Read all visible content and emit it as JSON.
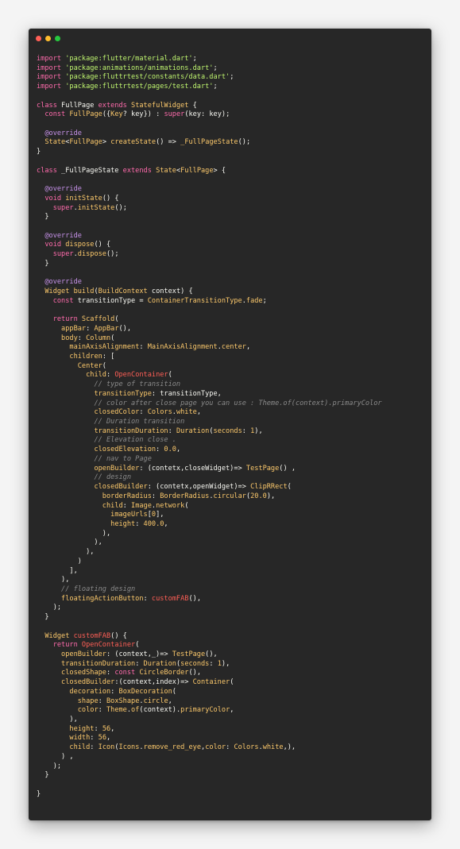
{
  "window": {
    "controls": [
      "close",
      "minimize",
      "maximize"
    ]
  },
  "colors": {
    "keyword": "#ff6bac",
    "string": "#bff56f",
    "type": "#fbc86b",
    "annotation": "#c792ea",
    "comment": "#8a8a8a",
    "error": "#ff5f56",
    "text": "#f8f8f2",
    "background": "#272727"
  },
  "code_lines": [
    [
      [
        "kw",
        "import "
      ],
      [
        "str",
        "'package:flutter/material.dart'"
      ],
      [
        "p",
        ";"
      ]
    ],
    [
      [
        "kw",
        "import "
      ],
      [
        "str",
        "'package:animations/animations.dart'"
      ],
      [
        "p",
        ";"
      ]
    ],
    [
      [
        "kw",
        "import "
      ],
      [
        "str",
        "'package:fluttrtest/constants/data.dart'"
      ],
      [
        "p",
        ";"
      ]
    ],
    [
      [
        "kw",
        "import "
      ],
      [
        "str",
        "'package:fluttrtest/pages/test.dart'"
      ],
      [
        "p",
        ";"
      ]
    ],
    [],
    [
      [
        "kw",
        "class "
      ],
      [
        "id",
        "FullPage "
      ],
      [
        "kw",
        "extends "
      ],
      [
        "cls",
        "StatefulWidget"
      ],
      [
        "p",
        " {"
      ]
    ],
    [
      [
        "p",
        "  "
      ],
      [
        "kw",
        "const "
      ],
      [
        "fn",
        "FullPage"
      ],
      [
        "p",
        "({"
      ],
      [
        "cls",
        "Key"
      ],
      [
        "p",
        "? key}) : "
      ],
      [
        "kw",
        "super"
      ],
      [
        "p",
        "(key: key);"
      ]
    ],
    [],
    [
      [
        "p",
        "  "
      ],
      [
        "ann",
        "@override"
      ]
    ],
    [
      [
        "p",
        "  "
      ],
      [
        "cls",
        "State"
      ],
      [
        "p",
        "<"
      ],
      [
        "cls",
        "FullPage"
      ],
      [
        "p",
        "> "
      ],
      [
        "fn",
        "createState"
      ],
      [
        "p",
        "() => "
      ],
      [
        "fn",
        "_FullPageState"
      ],
      [
        "p",
        "();"
      ]
    ],
    [
      [
        "p",
        "}"
      ]
    ],
    [],
    [
      [
        "kw",
        "class "
      ],
      [
        "id",
        "_FullPageState "
      ],
      [
        "kw",
        "extends "
      ],
      [
        "cls",
        "State"
      ],
      [
        "p",
        "<"
      ],
      [
        "cls",
        "FullPage"
      ],
      [
        "p",
        "> {"
      ]
    ],
    [],
    [
      [
        "p",
        "  "
      ],
      [
        "ann",
        "@override"
      ]
    ],
    [
      [
        "p",
        "  "
      ],
      [
        "kw",
        "void "
      ],
      [
        "fn",
        "initState"
      ],
      [
        "p",
        "() {"
      ]
    ],
    [
      [
        "p",
        "    "
      ],
      [
        "kw",
        "super"
      ],
      [
        "p",
        "."
      ],
      [
        "fn",
        "initState"
      ],
      [
        "p",
        "();"
      ]
    ],
    [
      [
        "p",
        "  }"
      ]
    ],
    [],
    [
      [
        "p",
        "  "
      ],
      [
        "ann",
        "@override"
      ]
    ],
    [
      [
        "p",
        "  "
      ],
      [
        "kw",
        "void "
      ],
      [
        "fn",
        "dispose"
      ],
      [
        "p",
        "() {"
      ]
    ],
    [
      [
        "p",
        "    "
      ],
      [
        "kw",
        "super"
      ],
      [
        "p",
        "."
      ],
      [
        "fn",
        "dispose"
      ],
      [
        "p",
        "();"
      ]
    ],
    [
      [
        "p",
        "  }"
      ]
    ],
    [],
    [
      [
        "p",
        "  "
      ],
      [
        "ann",
        "@override"
      ]
    ],
    [
      [
        "p",
        "  "
      ],
      [
        "cls",
        "Widget "
      ],
      [
        "fn",
        "build"
      ],
      [
        "p",
        "("
      ],
      [
        "cls",
        "BuildContext"
      ],
      [
        "p",
        " context) {"
      ]
    ],
    [
      [
        "p",
        "    "
      ],
      [
        "kw",
        "const "
      ],
      [
        "id",
        "transitionType "
      ],
      [
        "p",
        "= "
      ],
      [
        "cls",
        "ContainerTransitionType"
      ],
      [
        "p",
        "."
      ],
      [
        "prop",
        "fade"
      ],
      [
        "p",
        ";"
      ]
    ],
    [],
    [
      [
        "p",
        "    "
      ],
      [
        "kw",
        "return "
      ],
      [
        "cls",
        "Scaffold"
      ],
      [
        "p",
        "("
      ]
    ],
    [
      [
        "p",
        "      "
      ],
      [
        "prop",
        "appBar"
      ],
      [
        "p",
        ": "
      ],
      [
        "cls",
        "AppBar"
      ],
      [
        "p",
        "(),"
      ]
    ],
    [
      [
        "p",
        "      "
      ],
      [
        "prop",
        "body"
      ],
      [
        "p",
        ": "
      ],
      [
        "cls",
        "Column"
      ],
      [
        "p",
        "("
      ]
    ],
    [
      [
        "p",
        "        "
      ],
      [
        "prop",
        "mainAxisAlignment"
      ],
      [
        "p",
        ": "
      ],
      [
        "cls",
        "MainAxisAlignment"
      ],
      [
        "p",
        "."
      ],
      [
        "prop",
        "center"
      ],
      [
        "p",
        ","
      ]
    ],
    [
      [
        "p",
        "        "
      ],
      [
        "prop",
        "children"
      ],
      [
        "p",
        ": ["
      ]
    ],
    [
      [
        "p",
        "          "
      ],
      [
        "cls",
        "Center"
      ],
      [
        "p",
        "("
      ]
    ],
    [
      [
        "p",
        "            "
      ],
      [
        "prop",
        "child"
      ],
      [
        "p",
        ": "
      ],
      [
        "err",
        "OpenContainer"
      ],
      [
        "p",
        "("
      ]
    ],
    [
      [
        "p",
        "              "
      ],
      [
        "cmt",
        "// type of transition"
      ]
    ],
    [
      [
        "p",
        "              "
      ],
      [
        "prop",
        "transitionType"
      ],
      [
        "p",
        ": transitionType,"
      ]
    ],
    [
      [
        "p",
        "              "
      ],
      [
        "cmt",
        "// color after close page you can use : Theme.of(context).primaryColor"
      ]
    ],
    [
      [
        "p",
        "              "
      ],
      [
        "prop",
        "closedColor"
      ],
      [
        "p",
        ": "
      ],
      [
        "cls",
        "Colors"
      ],
      [
        "p",
        "."
      ],
      [
        "prop",
        "white"
      ],
      [
        "p",
        ","
      ]
    ],
    [
      [
        "p",
        "              "
      ],
      [
        "cmt",
        "// Duration transition"
      ]
    ],
    [
      [
        "p",
        "              "
      ],
      [
        "prop",
        "transitionDuration"
      ],
      [
        "p",
        ": "
      ],
      [
        "cls",
        "Duration"
      ],
      [
        "p",
        "("
      ],
      [
        "prop",
        "seconds"
      ],
      [
        "p",
        ": "
      ],
      [
        "num",
        "1"
      ],
      [
        "p",
        "),"
      ]
    ],
    [
      [
        "p",
        "              "
      ],
      [
        "cmt",
        "// Elevation close ."
      ]
    ],
    [
      [
        "p",
        "              "
      ],
      [
        "prop",
        "closedElevation"
      ],
      [
        "p",
        ": "
      ],
      [
        "num",
        "0.0"
      ],
      [
        "p",
        ","
      ]
    ],
    [
      [
        "p",
        "              "
      ],
      [
        "cmt",
        "// nav to Page"
      ]
    ],
    [
      [
        "p",
        "              "
      ],
      [
        "prop",
        "openBuilder"
      ],
      [
        "p",
        ": (contetx,closeWidget)=> "
      ],
      [
        "cls",
        "TestPage"
      ],
      [
        "p",
        "() ,"
      ]
    ],
    [
      [
        "p",
        "              "
      ],
      [
        "cmt",
        "// design"
      ]
    ],
    [
      [
        "p",
        "              "
      ],
      [
        "prop",
        "closedBuilder"
      ],
      [
        "p",
        ": (contetx,openWidget)=> "
      ],
      [
        "cls",
        "ClipRRect"
      ],
      [
        "p",
        "("
      ]
    ],
    [
      [
        "p",
        "                "
      ],
      [
        "prop",
        "borderRadius"
      ],
      [
        "p",
        ": "
      ],
      [
        "cls",
        "BorderRadius"
      ],
      [
        "p",
        "."
      ],
      [
        "fn",
        "circular"
      ],
      [
        "p",
        "("
      ],
      [
        "num",
        "20.0"
      ],
      [
        "p",
        "),"
      ]
    ],
    [
      [
        "p",
        "                "
      ],
      [
        "prop",
        "child"
      ],
      [
        "p",
        ": "
      ],
      [
        "cls",
        "Image"
      ],
      [
        "p",
        "."
      ],
      [
        "fn",
        "network"
      ],
      [
        "p",
        "("
      ]
    ],
    [
      [
        "p",
        "                  "
      ],
      [
        "prop",
        "imageUrls"
      ],
      [
        "p",
        "["
      ],
      [
        "num",
        "0"
      ],
      [
        "p",
        "],"
      ]
    ],
    [
      [
        "p",
        "                  "
      ],
      [
        "prop",
        "height"
      ],
      [
        "p",
        ": "
      ],
      [
        "num",
        "400.0"
      ],
      [
        "p",
        ","
      ]
    ],
    [
      [
        "p",
        "                ),"
      ]
    ],
    [
      [
        "p",
        "              ),"
      ]
    ],
    [
      [
        "p",
        "            ),"
      ]
    ],
    [
      [
        "p",
        "          )"
      ]
    ],
    [
      [
        "p",
        "        ],"
      ]
    ],
    [
      [
        "p",
        "      ),"
      ]
    ],
    [
      [
        "p",
        "      "
      ],
      [
        "cmt",
        "// floating design"
      ]
    ],
    [
      [
        "p",
        "      "
      ],
      [
        "prop",
        "floatingActionButton"
      ],
      [
        "p",
        ": "
      ],
      [
        "err",
        "customFAB"
      ],
      [
        "p",
        "(),"
      ]
    ],
    [
      [
        "p",
        "    );"
      ]
    ],
    [
      [
        "p",
        "  }"
      ]
    ],
    [],
    [
      [
        "p",
        "  "
      ],
      [
        "cls",
        "Widget "
      ],
      [
        "err",
        "customFAB"
      ],
      [
        "p",
        "() {"
      ]
    ],
    [
      [
        "p",
        "    "
      ],
      [
        "kw",
        "return "
      ],
      [
        "err",
        "OpenContainer"
      ],
      [
        "p",
        "("
      ]
    ],
    [
      [
        "p",
        "      "
      ],
      [
        "prop",
        "openBuilder"
      ],
      [
        "p",
        ": (context,_)=> "
      ],
      [
        "cls",
        "TestPage"
      ],
      [
        "p",
        "(),"
      ]
    ],
    [
      [
        "p",
        "      "
      ],
      [
        "prop",
        "transitionDuration"
      ],
      [
        "p",
        ": "
      ],
      [
        "cls",
        "Duration"
      ],
      [
        "p",
        "("
      ],
      [
        "prop",
        "seconds"
      ],
      [
        "p",
        ": "
      ],
      [
        "num",
        "1"
      ],
      [
        "p",
        "),"
      ]
    ],
    [
      [
        "p",
        "      "
      ],
      [
        "prop",
        "closedShape"
      ],
      [
        "p",
        ": "
      ],
      [
        "kw",
        "const "
      ],
      [
        "cls",
        "CircleBorder"
      ],
      [
        "p",
        "(),"
      ]
    ],
    [
      [
        "p",
        "      "
      ],
      [
        "prop",
        "closedBuilder"
      ],
      [
        "p",
        ":(context,index)=> "
      ],
      [
        "cls",
        "Container"
      ],
      [
        "p",
        "("
      ]
    ],
    [
      [
        "p",
        "        "
      ],
      [
        "prop",
        "decoration"
      ],
      [
        "p",
        ": "
      ],
      [
        "cls",
        "BoxDecoration"
      ],
      [
        "p",
        "("
      ]
    ],
    [
      [
        "p",
        "          "
      ],
      [
        "prop",
        "shape"
      ],
      [
        "p",
        ": "
      ],
      [
        "cls",
        "BoxShape"
      ],
      [
        "p",
        "."
      ],
      [
        "prop",
        "circle"
      ],
      [
        "p",
        ","
      ]
    ],
    [
      [
        "p",
        "          "
      ],
      [
        "prop",
        "color"
      ],
      [
        "p",
        ": "
      ],
      [
        "cls",
        "Theme"
      ],
      [
        "p",
        "."
      ],
      [
        "fn",
        "of"
      ],
      [
        "p",
        "(context)."
      ],
      [
        "prop",
        "primaryColor"
      ],
      [
        "p",
        ","
      ]
    ],
    [
      [
        "p",
        "        ),"
      ]
    ],
    [
      [
        "p",
        "        "
      ],
      [
        "prop",
        "height"
      ],
      [
        "p",
        ": "
      ],
      [
        "num",
        "56"
      ],
      [
        "p",
        ","
      ]
    ],
    [
      [
        "p",
        "        "
      ],
      [
        "prop",
        "width"
      ],
      [
        "p",
        ": "
      ],
      [
        "num",
        "56"
      ],
      [
        "p",
        ","
      ]
    ],
    [
      [
        "p",
        "        "
      ],
      [
        "prop",
        "child"
      ],
      [
        "p",
        ": "
      ],
      [
        "cls",
        "Icon"
      ],
      [
        "p",
        "("
      ],
      [
        "cls",
        "Icons"
      ],
      [
        "p",
        "."
      ],
      [
        "prop",
        "remove_red_eye"
      ],
      [
        "p",
        ","
      ],
      [
        "prop",
        "color"
      ],
      [
        "p",
        ": "
      ],
      [
        "cls",
        "Colors"
      ],
      [
        "p",
        "."
      ],
      [
        "prop",
        "white"
      ],
      [
        "p",
        ",),"
      ]
    ],
    [
      [
        "p",
        "      ) ,"
      ]
    ],
    [
      [
        "p",
        "    );"
      ]
    ],
    [
      [
        "p",
        "  }"
      ]
    ],
    [],
    [
      [
        "p",
        "}"
      ]
    ]
  ]
}
